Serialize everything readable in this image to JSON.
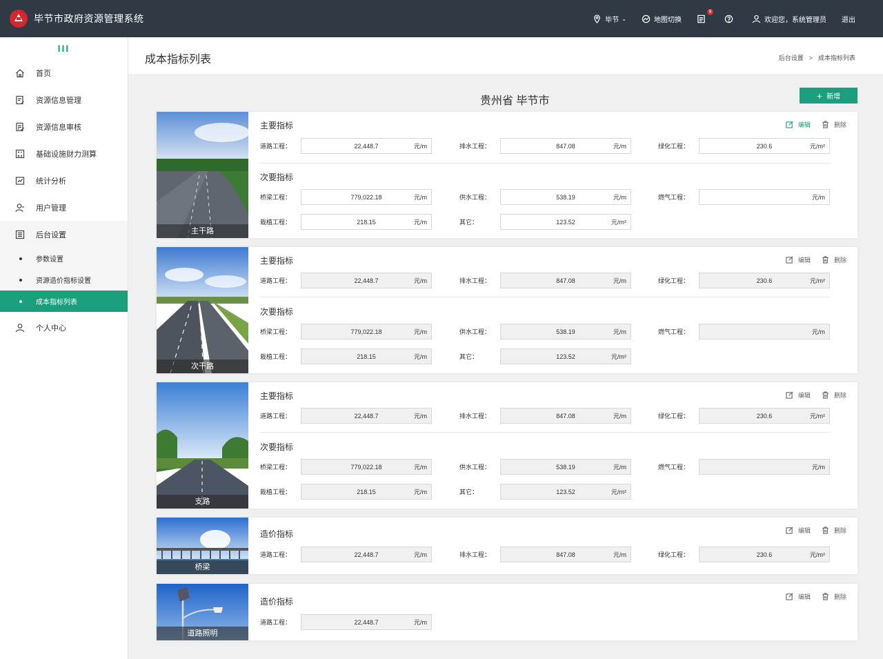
{
  "header": {
    "title": "毕节市政府资源管理系统",
    "location": "毕节",
    "map_switch": "地图切换",
    "notification_count": "9",
    "welcome": "欢迎您，系统管理员",
    "logout": "退出"
  },
  "sidebar": {
    "items": [
      {
        "label": "首页",
        "icon": "home-icon"
      },
      {
        "label": "资源信息管理",
        "icon": "edit-doc-icon"
      },
      {
        "label": "资源信息审核",
        "icon": "audit-doc-icon"
      },
      {
        "label": "基础设施财力测算",
        "icon": "calculator-icon"
      },
      {
        "label": "统计分析",
        "icon": "chart-icon"
      },
      {
        "label": "用户管理",
        "icon": "user-icon"
      },
      {
        "label": "后台设置",
        "icon": "settings-list-icon"
      }
    ],
    "sub_items": [
      "参数设置",
      "资源造价指标设置",
      "成本指标列表"
    ],
    "personal": "个人中心"
  },
  "page": {
    "title": "成本指标列表",
    "breadcrumb_parent": "后台设置",
    "breadcrumb_sep": ">",
    "breadcrumb_current": "成本指标列表",
    "region": "贵州省 毕节市",
    "add_label": "新增"
  },
  "labels": {
    "main": "主要指标",
    "secondary": "次要指标",
    "cost": "造价指标",
    "edit": "编辑",
    "delete": "删除",
    "road": "道路工程：",
    "drain": "排水工程：",
    "green": "绿化工程：",
    "bridge": "桥梁工程：",
    "water": "供水工程：",
    "gas": "燃气工程：",
    "plant": "栽植工程：",
    "other": "其它："
  },
  "units": {
    "m": "元/m",
    "m2": "元/m²"
  },
  "values": {
    "road": "22,448.7",
    "drain": "847.08",
    "green": "230.6",
    "bridge": "779,022.18",
    "water": "538.19",
    "gas": "",
    "plant": "218.15",
    "other": "123.52"
  },
  "cards": [
    {
      "caption": "主干路"
    },
    {
      "caption": "次干路"
    },
    {
      "caption": "支路"
    },
    {
      "caption": "桥梁"
    },
    {
      "caption": "道路照明"
    }
  ]
}
